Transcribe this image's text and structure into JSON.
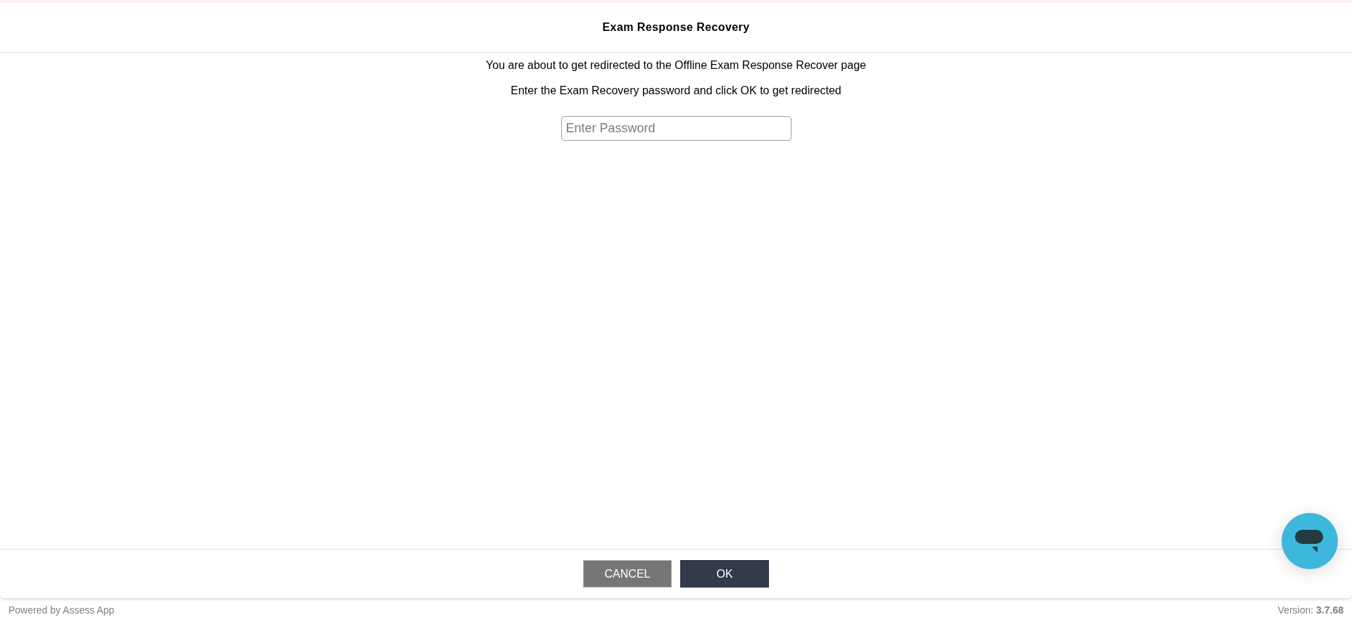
{
  "dialog": {
    "title": "Exam Response Recovery",
    "messages": [
      "You are about to get redirected to the Offline Exam Response Recover page",
      "Enter the Exam Recovery password and click OK to get redirected"
    ],
    "password_field": {
      "placeholder": "Enter Password"
    },
    "buttons": [
      {
        "kind": "secondary",
        "label": "CANCEL"
      },
      {
        "kind": "primary",
        "label": "OK"
      }
    ]
  },
  "footer": {
    "powered_by": "Powered by Assess App",
    "version": "Version: **3.7.68**"
  }
}
